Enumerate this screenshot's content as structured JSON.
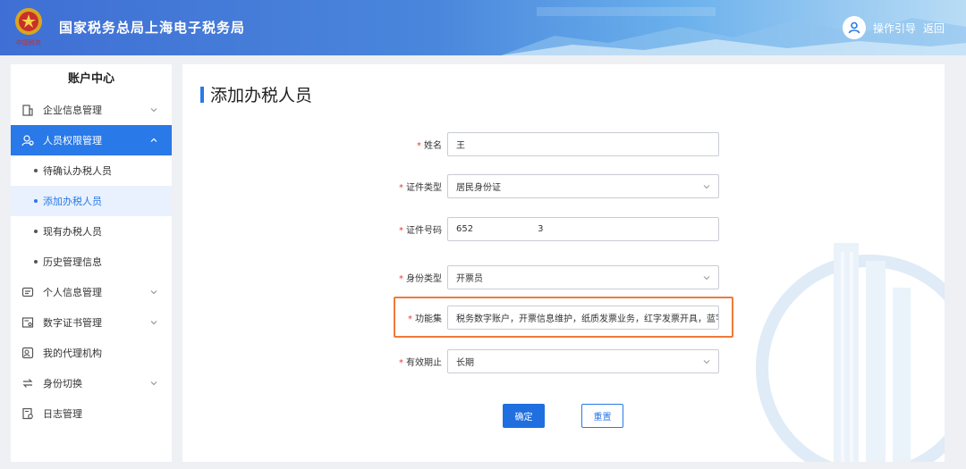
{
  "header": {
    "title": "国家税务总局上海电子税务局",
    "logo_text": "中国税务",
    "guide_label": "操作引导",
    "back_label": "返回"
  },
  "sidebar": {
    "title": "账户中心",
    "items": [
      {
        "label": "企业信息管理",
        "icon": "building-icon"
      },
      {
        "label": "人员权限管理",
        "icon": "user-lock-icon"
      },
      {
        "label": "待确认办税人员"
      },
      {
        "label": "添加办税人员"
      },
      {
        "label": "现有办税人员"
      },
      {
        "label": "历史管理信息"
      },
      {
        "label": "个人信息管理",
        "icon": "id-card-icon"
      },
      {
        "label": "数字证书管理",
        "icon": "certificate-icon"
      },
      {
        "label": "我的代理机构",
        "icon": "agency-icon"
      },
      {
        "label": "身份切换",
        "icon": "switch-icon"
      },
      {
        "label": "日志管理",
        "icon": "log-icon"
      }
    ]
  },
  "main": {
    "title": "添加办税人员",
    "form": {
      "name_label": "姓名",
      "name_value": "王",
      "id_type_label": "证件类型",
      "id_type_value": "居民身份证",
      "id_number_label": "证件号码",
      "id_number_prefix": "652",
      "id_number_suffix": "3",
      "identity_type_label": "身份类型",
      "identity_type_value": "开票员",
      "function_label": "功能集",
      "function_value": "税务数字账户，开票信息维护，纸质发票业务，红字发票开具，蓝字",
      "validity_label": "有效期止",
      "validity_value": "长期"
    },
    "confirm_label": "确定",
    "reset_label": "重置"
  },
  "colors": {
    "primary": "#2979e8",
    "highlight": "#ef7a3a",
    "required": "#e0403a"
  }
}
